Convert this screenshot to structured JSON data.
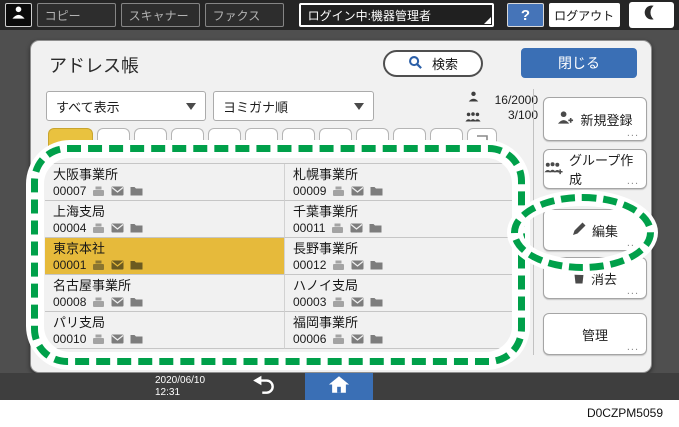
{
  "topbar": {
    "function_tabs": [
      {
        "label": "コピー"
      },
      {
        "label": "スキャナー"
      },
      {
        "label": "ファクス"
      }
    ],
    "login_status": "ログイン中:機器管理者",
    "help_label": "?",
    "logout_label": "ログアウト"
  },
  "panel": {
    "title": "アドレス帳",
    "search_label": "検索",
    "close_label": "閉じる",
    "filters": {
      "view": "すべて表示",
      "sort": "ヨミガナ順"
    },
    "counts": {
      "contacts": "16/2000",
      "groups": "3/100"
    },
    "entries": [
      {
        "name": "大阪事業所",
        "number": "00007",
        "selected": false
      },
      {
        "name": "札幌事業所",
        "number": "00009",
        "selected": false
      },
      {
        "name": "上海支局",
        "number": "00004",
        "selected": false
      },
      {
        "name": "千葉事業所",
        "number": "00011",
        "selected": false
      },
      {
        "name": "東京本社",
        "number": "00001",
        "selected": true
      },
      {
        "name": "長野事業所",
        "number": "00012",
        "selected": false
      },
      {
        "name": "名古屋事業所",
        "number": "00008",
        "selected": false
      },
      {
        "name": "ハノイ支局",
        "number": "00003",
        "selected": false
      },
      {
        "name": "パリ支局",
        "number": "00010",
        "selected": false
      },
      {
        "name": "福岡事業所",
        "number": "00006",
        "selected": false
      }
    ],
    "actions": [
      {
        "label": "新規登録",
        "icon": "person-add-icon",
        "ellipsis": "..."
      },
      {
        "label": "グループ作成",
        "icon": "group-add-icon",
        "ellipsis": "..."
      },
      {
        "label": "編集",
        "icon": "pencil-icon",
        "ellipsis": "..."
      },
      {
        "label": "消去",
        "icon": "trash-icon",
        "ellipsis": "..."
      },
      {
        "label": "管理",
        "icon": "",
        "ellipsis": "..."
      }
    ]
  },
  "footer": {
    "date": "2020/06/10",
    "time": "12:31"
  },
  "figure_code": "D0CZPM5059",
  "colors": {
    "accent_blue": "#3a6fb5",
    "selected_yellow": "#e6ba3b",
    "annotation_green": "#00a04a",
    "topbar_dark": "#252525"
  }
}
